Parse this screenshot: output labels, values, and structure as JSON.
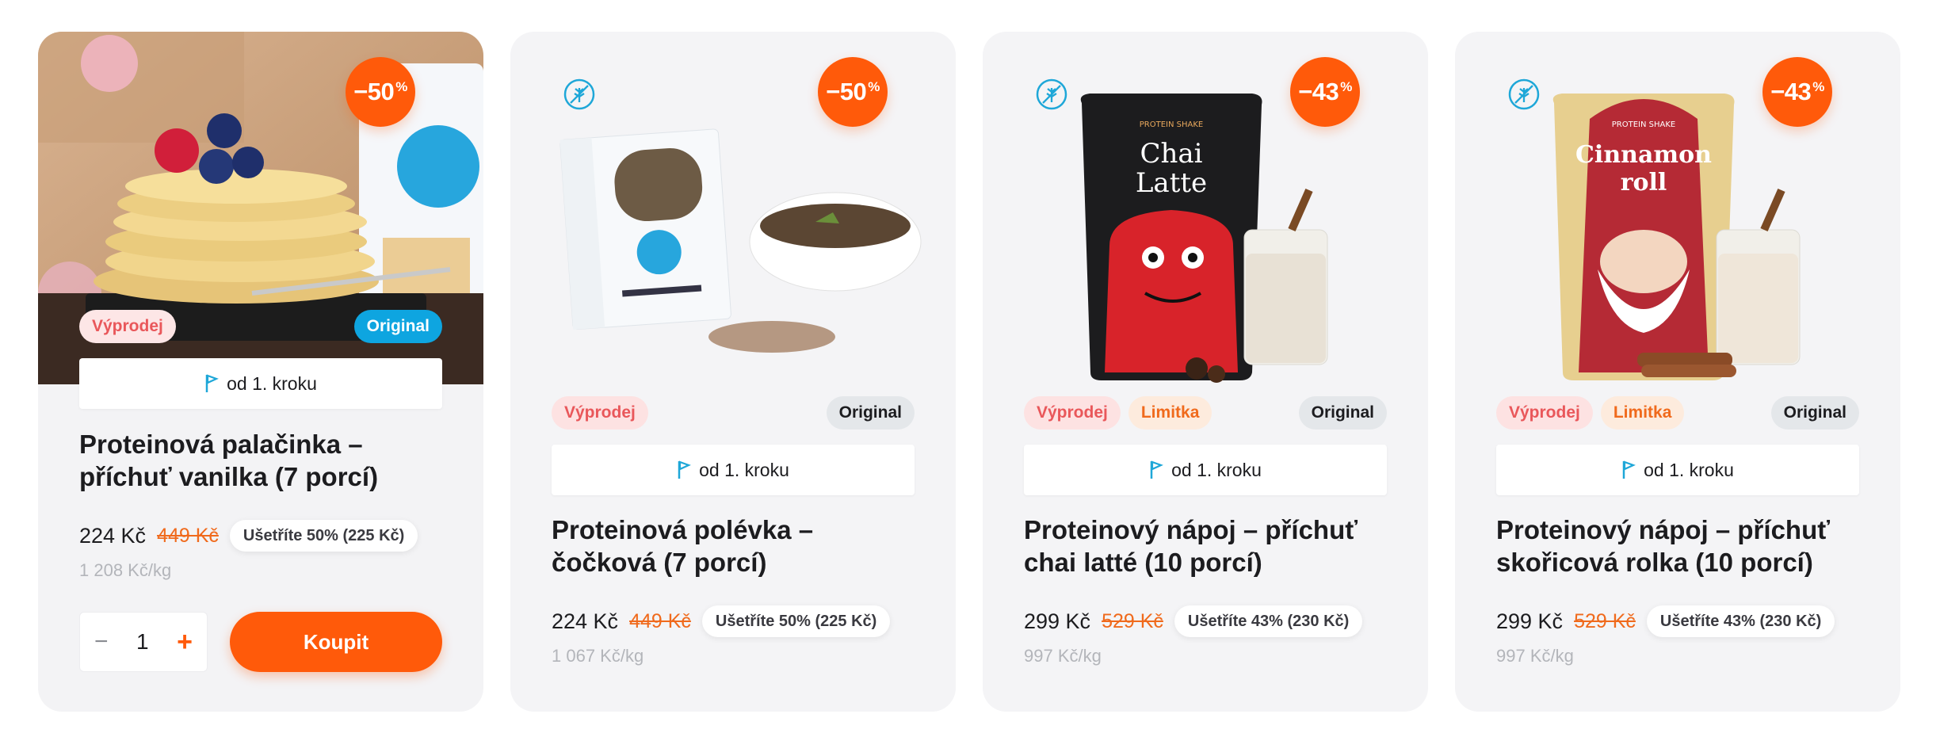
{
  "colors": {
    "accent": "#ff5a0a",
    "sale_badge": "#e9575a",
    "limit_badge": "#f06a1c",
    "original_blue": "#0ea5e0",
    "step_flag": "#1ea7d8"
  },
  "products": [
    {
      "discount": "−50",
      "discount_unit": "%",
      "badges": {
        "sale": "Výprodej",
        "original": "Original"
      },
      "step": "od 1. kroku",
      "title": "Proteinová palačinka – příchuť vanilka (7 porcí)",
      "price": "224 Kč",
      "old_price": "449 Kč",
      "save": "Ušetříte 50% (225 Kč)",
      "per_kg": "1 208 Kč/kg",
      "quantity": "1",
      "buy_label": "Koupit"
    },
    {
      "discount": "−50",
      "discount_unit": "%",
      "badges": {
        "sale": "Výprodej",
        "original": "Original"
      },
      "step": "od 1. kroku",
      "title": "Proteinová polévka – čočková (7 porcí)",
      "price": "224 Kč",
      "old_price": "449 Kč",
      "save": "Ušetříte 50% (225 Kč)",
      "per_kg": "1 067 Kč/kg",
      "icon": "wheat-free-icon"
    },
    {
      "discount": "−43",
      "discount_unit": "%",
      "badges": {
        "sale": "Výprodej",
        "limit": "Limitka",
        "original": "Original"
      },
      "step": "od 1. kroku",
      "title": "Proteinový nápoj – příchuť chai latté (10 porcí)",
      "price": "299 Kč",
      "old_price": "529 Kč",
      "save": "Ušetříte 43% (230 Kč)",
      "per_kg": "997 Kč/kg",
      "icon": "wheat-free-icon",
      "package_text": {
        "top": "PROTEIN SHAKE",
        "name_1": "Chai",
        "name_2": "Latte"
      }
    },
    {
      "discount": "−43",
      "discount_unit": "%",
      "badges": {
        "sale": "Výprodej",
        "limit": "Limitka",
        "original": "Original"
      },
      "step": "od 1. kroku",
      "title": "Proteinový nápoj – příchuť skořicová rolka (10 porcí)",
      "price": "299 Kč",
      "old_price": "529 Kč",
      "save": "Ušetříte 43% (230 Kč)",
      "per_kg": "997 Kč/kg",
      "icon": "wheat-free-icon",
      "package_text": {
        "top": "PROTEIN SHAKE",
        "name_1": "Cinnamon",
        "name_2": "roll"
      }
    }
  ]
}
